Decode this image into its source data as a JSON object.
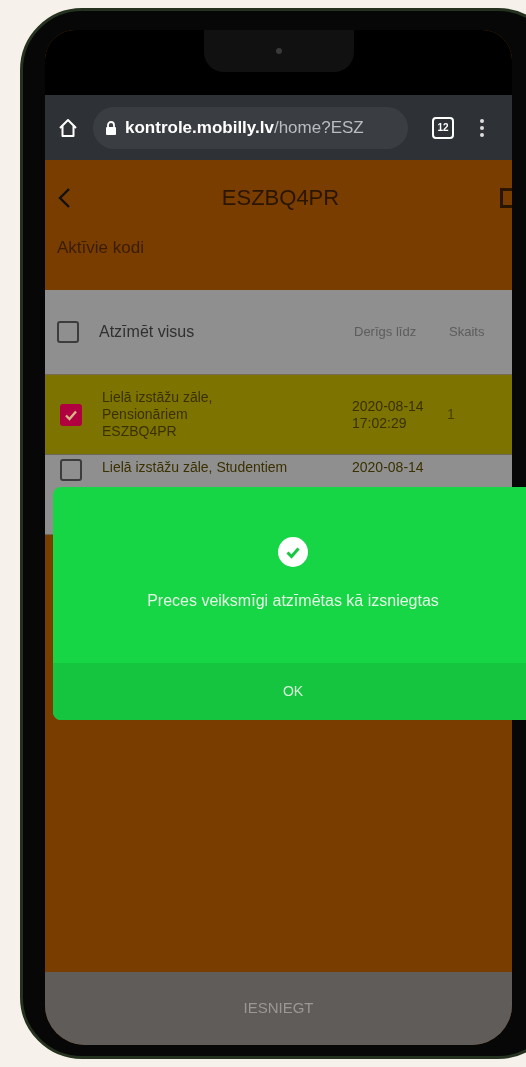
{
  "browser": {
    "url_host": "kontrole.mobilly.lv",
    "url_path": "/home?ESZ",
    "tab_count": "12"
  },
  "header": {
    "title": "ESZBQ4PR"
  },
  "section_title": "Aktīvie kodi",
  "table": {
    "select_all": {
      "label": "Atzīmēt visus",
      "checked": false
    },
    "columns": [
      "Derīgs līdz",
      "Skaits"
    ],
    "rows": [
      {
        "name": [
          "Lielā izstāžu zāle,",
          "Pensionāriem",
          "ESZBQ4PR"
        ],
        "valid_until": [
          "2020-08-14",
          "17:02:29"
        ],
        "count": "1",
        "checked": true
      },
      {
        "name": [
          "Lielā izstāžu zāle, Studentiem"
        ],
        "valid_until": [
          "2020-08-14"
        ],
        "checked": false
      }
    ]
  },
  "dialog": {
    "message": "Preces veiksmīgi atzīmētas kā izsniegtas",
    "button": "OK"
  },
  "footer": {
    "button": "IESNIEGT"
  }
}
